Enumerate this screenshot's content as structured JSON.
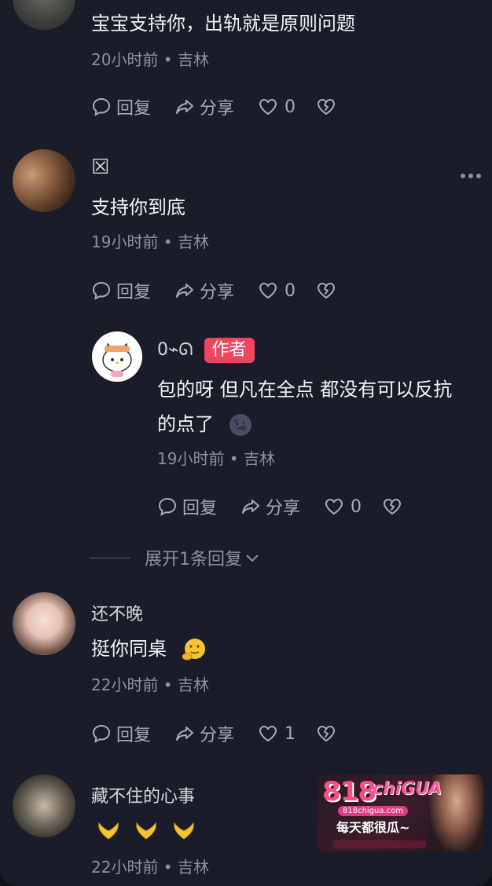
{
  "comments": [
    {
      "text": "宝宝支持你，出轨就是原则问题",
      "meta": "20小时前 • 吉林",
      "actions": {
        "reply": "回复",
        "share": "分享",
        "likes": "0"
      }
    },
    {
      "name": "☒",
      "text": "支持你到底",
      "meta": "19小时前 • 吉林",
      "actions": {
        "reply": "回复",
        "share": "分享",
        "likes": "0"
      }
    },
    {
      "name": "0⌁ᘏ",
      "badge": "作者",
      "text_line1": "包的呀 但凡在全点 都没有可以反抗",
      "text_line2": "的点了",
      "meta": "19小时前 • 吉林",
      "actions": {
        "reply": "回复",
        "share": "分享",
        "likes": "0"
      }
    },
    {
      "name": "还不晚",
      "text": "挺你同桌",
      "meta": "22小时前 • 吉林",
      "actions": {
        "reply": "回复",
        "share": "分享",
        "likes": "1"
      }
    },
    {
      "name": "藏不住的心事",
      "meta": "22小时前 • 吉林"
    }
  ],
  "expand_replies": "展开1条回复",
  "ad": {
    "brand_number": "818",
    "brand_name": "chiGUA",
    "url": "818chigua.com",
    "slogan": "每天都很瓜~"
  },
  "colors": {
    "background": "#1a1d29",
    "author_badge": "#f0445f",
    "meta_text": "#8e909b"
  }
}
